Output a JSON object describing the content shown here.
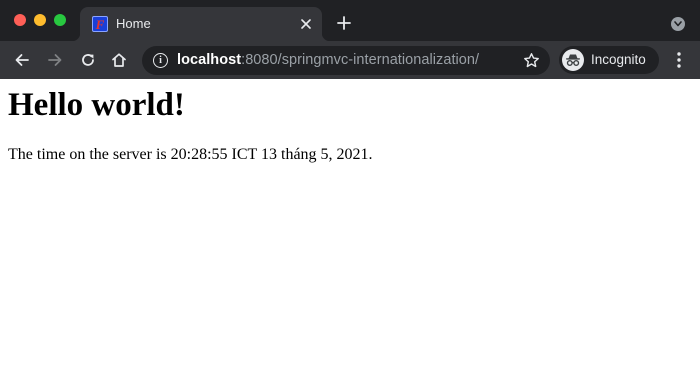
{
  "window": {
    "tab": {
      "title": "Home",
      "favicon": "spring-app-favicon"
    },
    "icons": {
      "close_tab": "close-icon",
      "new_tab": "plus-icon",
      "tab_search": "chevron-down-icon",
      "back": "arrow-left-icon",
      "forward": "arrow-right-icon",
      "reload": "reload-icon",
      "home": "home-icon",
      "site_info": "info-icon",
      "bookmark": "star-icon",
      "profile": "incognito-icon",
      "menu": "more-vert-icon"
    },
    "colors": {
      "tabstrip_bg": "#202124",
      "toolbar_bg": "#35363a",
      "omnibox_bg": "#202124",
      "traffic_close": "#fe5f57",
      "traffic_minimize": "#febc2e",
      "traffic_maximize": "#28c840"
    }
  },
  "toolbar": {
    "address": {
      "host": "localhost",
      "path": ":8080/springmvc-internationalization/"
    },
    "profile_label": "Incognito"
  },
  "page": {
    "heading": "Hello world!",
    "paragraph": "The time on the server is 20:28:55 ICT 13 tháng 5, 2021."
  }
}
